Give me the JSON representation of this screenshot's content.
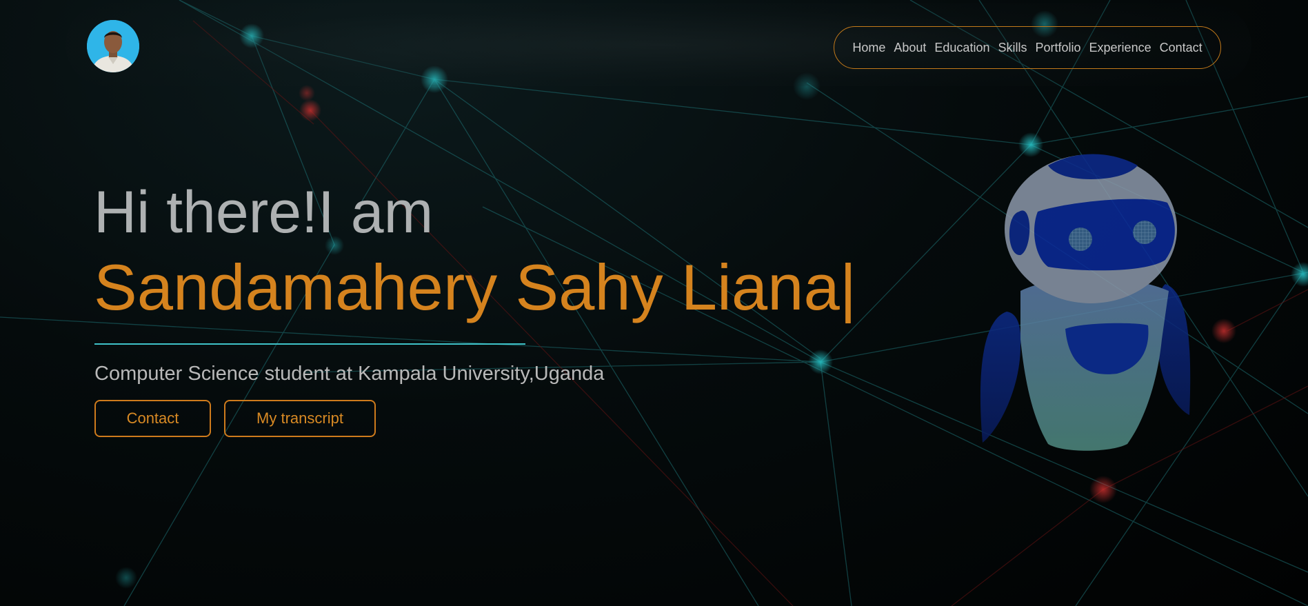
{
  "nav": {
    "items": [
      "Home",
      "About",
      "Education",
      "Skills",
      "Portfolio",
      "Experience",
      "Contact"
    ]
  },
  "hero": {
    "greeting": "Hi there!I am",
    "name": "Sandamahery Sahy Liana",
    "cursor": "|",
    "subtitle": "Computer Science student at Kampala University,Uganda"
  },
  "buttons": {
    "contact": "Contact",
    "transcript": "My transcript"
  },
  "colors": {
    "accent": "#d5831e",
    "line": "#3fc3c9",
    "node": "#1a9aa0",
    "node_red": "#b3262a",
    "robot_blue": "#0f2a8a"
  },
  "icons": {
    "avatar": "profile-photo",
    "robot": "robot-illustration"
  }
}
